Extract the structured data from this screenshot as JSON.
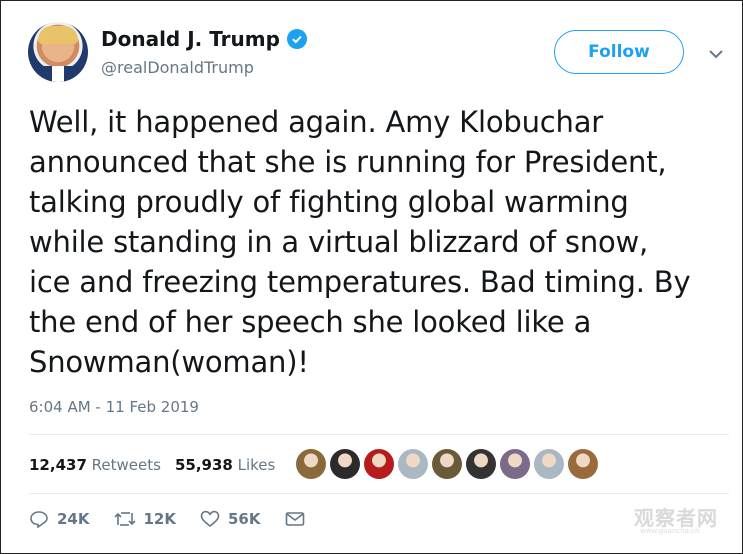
{
  "author": {
    "name": "Donald J. Trump",
    "handle": "@realDonaldTrump",
    "verified": true
  },
  "follow_label": "Follow",
  "tweet_lines": [
    "Well, it happened again. Amy Klobuchar",
    "announced that she is running for President,",
    "talking proudly of fighting global warming",
    "while standing in a virtual blizzard of snow,",
    "ice and freezing temperatures. Bad timing. By",
    "the end of her speech she looked like a",
    "Snowman(woman)!"
  ],
  "timestamp": "6:04 AM - 11 Feb 2019",
  "stats": {
    "retweets_count": "12,437",
    "retweets_label": "Retweets",
    "likes_count": "55,938",
    "likes_label": "Likes"
  },
  "liker_avatars": [
    "#8a6a3a",
    "#2b2b2b",
    "#b71c1c",
    "#aab8c2",
    "#6b5a3a",
    "#333333",
    "#7a6b8a",
    "#aab8c2",
    "#9a6a3a"
  ],
  "actions": {
    "replies": "24K",
    "retweets": "12K",
    "likes": "56K"
  },
  "watermark": {
    "text": "观察者网",
    "sub": "www.guancha.cn"
  },
  "colors": {
    "accent": "#1da1f2",
    "muted": "#657786",
    "text": "#14171a"
  }
}
